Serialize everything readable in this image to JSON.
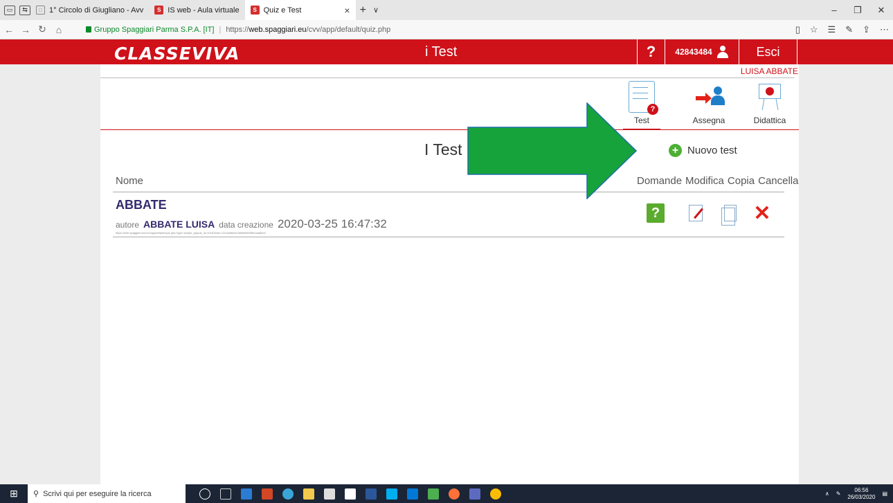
{
  "browser": {
    "tabs": [
      {
        "label": "1° Circolo di Giugliano - Avv",
        "active": false
      },
      {
        "label": "IS web - Aula virtuale",
        "active": false
      },
      {
        "label": "Quiz e Test",
        "active": true
      }
    ],
    "cert_label": "Gruppo Spaggiari Parma S.P.A. [IT]",
    "url_prefix": "https://",
    "url_domain": "web.spaggiari.eu",
    "url_path": "/cvv/app/default/quiz.php"
  },
  "header": {
    "logo": "CLASSEVIVA",
    "title": "i Test",
    "help": "?",
    "user_code": "42843484",
    "exit": "Esci",
    "brand_color": "#cf111a"
  },
  "user_name": "LUISA ABBATE",
  "tools": {
    "test": "Test",
    "assign": "Assegna",
    "didattica": "Didattica"
  },
  "main": {
    "title": "I Test",
    "new_test": "Nuovo test",
    "col_name": "Nome",
    "col_domande": "Domande",
    "col_modifica": "Modifica",
    "col_copia": "Copia",
    "col_cancella": "Cancella"
  },
  "quiz": {
    "name": "ABBATE",
    "author_label": "autore",
    "author": "ABBATE LUISA",
    "date_label": "data creazione",
    "date": "2020-03-25 16:47:32",
    "url": "https://web.spaggiari.eu/cvv/app/default/quiz.php?type=simple_q&quiz_id=10151&idc=221dad6a912af8845e6f9b1aaafcb4"
  },
  "taskbar": {
    "search_placeholder": "Scrivi qui per eseguire la ricerca",
    "time": "06:56",
    "date": "26/03/2020"
  }
}
